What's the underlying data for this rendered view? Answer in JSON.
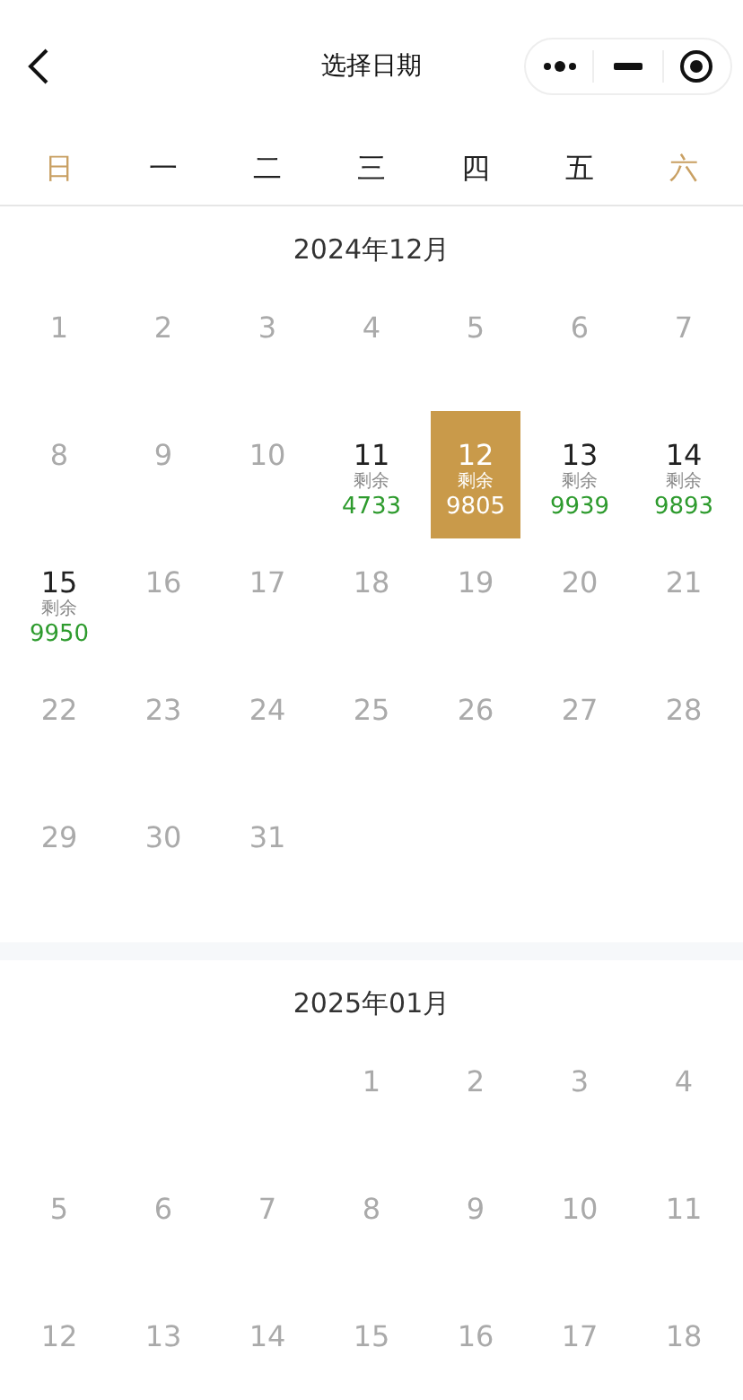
{
  "nav": {
    "title": "选择日期"
  },
  "weekdays": [
    {
      "label": "日",
      "color": "#c9a063"
    },
    {
      "label": "一",
      "color": "#222222"
    },
    {
      "label": "二",
      "color": "#222222"
    },
    {
      "label": "三",
      "color": "#222222"
    },
    {
      "label": "四",
      "color": "#222222"
    },
    {
      "label": "五",
      "color": "#222222"
    },
    {
      "label": "六",
      "color": "#c9a063"
    }
  ],
  "months": [
    {
      "title": "2024年12月",
      "days": [
        {
          "kind": "day",
          "label": "1",
          "disabled": true,
          "selected": false
        },
        {
          "kind": "day",
          "label": "2",
          "disabled": true,
          "selected": false
        },
        {
          "kind": "day",
          "label": "3",
          "disabled": true,
          "selected": false
        },
        {
          "kind": "day",
          "label": "4",
          "disabled": true,
          "selected": false
        },
        {
          "kind": "day",
          "label": "5",
          "disabled": true,
          "selected": false
        },
        {
          "kind": "day",
          "label": "6",
          "disabled": true,
          "selected": false
        },
        {
          "kind": "day",
          "label": "7",
          "disabled": true,
          "selected": false
        },
        {
          "kind": "day",
          "label": "8",
          "disabled": true,
          "selected": false
        },
        {
          "kind": "day",
          "label": "9",
          "disabled": true,
          "selected": false
        },
        {
          "kind": "day",
          "label": "10",
          "disabled": true,
          "selected": false
        },
        {
          "kind": "day",
          "label": "11",
          "disabled": false,
          "selected": false,
          "caption": "剩余",
          "count": "4733"
        },
        {
          "kind": "day",
          "label": "12",
          "disabled": false,
          "selected": true,
          "caption": "剩余",
          "count": "9805"
        },
        {
          "kind": "day",
          "label": "13",
          "disabled": false,
          "selected": false,
          "caption": "剩余",
          "count": "9939"
        },
        {
          "kind": "day",
          "label": "14",
          "disabled": false,
          "selected": false,
          "caption": "剩余",
          "count": "9893"
        },
        {
          "kind": "day",
          "label": "15",
          "disabled": false,
          "selected": false,
          "caption": "剩余",
          "count": "9950"
        },
        {
          "kind": "day",
          "label": "16",
          "disabled": true,
          "selected": false
        },
        {
          "kind": "day",
          "label": "17",
          "disabled": true,
          "selected": false
        },
        {
          "kind": "day",
          "label": "18",
          "disabled": true,
          "selected": false
        },
        {
          "kind": "day",
          "label": "19",
          "disabled": true,
          "selected": false
        },
        {
          "kind": "day",
          "label": "20",
          "disabled": true,
          "selected": false
        },
        {
          "kind": "day",
          "label": "21",
          "disabled": true,
          "selected": false
        },
        {
          "kind": "day",
          "label": "22",
          "disabled": true,
          "selected": false
        },
        {
          "kind": "day",
          "label": "23",
          "disabled": true,
          "selected": false
        },
        {
          "kind": "day",
          "label": "24",
          "disabled": true,
          "selected": false
        },
        {
          "kind": "day",
          "label": "25",
          "disabled": true,
          "selected": false
        },
        {
          "kind": "day",
          "label": "26",
          "disabled": true,
          "selected": false
        },
        {
          "kind": "day",
          "label": "27",
          "disabled": true,
          "selected": false
        },
        {
          "kind": "day",
          "label": "28",
          "disabled": true,
          "selected": false
        },
        {
          "kind": "day",
          "label": "29",
          "disabled": true,
          "selected": false
        },
        {
          "kind": "day",
          "label": "30",
          "disabled": true,
          "selected": false
        },
        {
          "kind": "day",
          "label": "31",
          "disabled": true,
          "selected": false
        }
      ]
    },
    {
      "title": "2025年01月",
      "days": [
        {
          "kind": "blank"
        },
        {
          "kind": "blank"
        },
        {
          "kind": "blank"
        },
        {
          "kind": "day",
          "label": "1",
          "disabled": true,
          "selected": false
        },
        {
          "kind": "day",
          "label": "2",
          "disabled": true,
          "selected": false
        },
        {
          "kind": "day",
          "label": "3",
          "disabled": true,
          "selected": false
        },
        {
          "kind": "day",
          "label": "4",
          "disabled": true,
          "selected": false
        },
        {
          "kind": "day",
          "label": "5",
          "disabled": true,
          "selected": false
        },
        {
          "kind": "day",
          "label": "6",
          "disabled": true,
          "selected": false
        },
        {
          "kind": "day",
          "label": "7",
          "disabled": true,
          "selected": false
        },
        {
          "kind": "day",
          "label": "8",
          "disabled": true,
          "selected": false
        },
        {
          "kind": "day",
          "label": "9",
          "disabled": true,
          "selected": false
        },
        {
          "kind": "day",
          "label": "10",
          "disabled": true,
          "selected": false
        },
        {
          "kind": "day",
          "label": "11",
          "disabled": true,
          "selected": false
        },
        {
          "kind": "day",
          "label": "12",
          "disabled": true,
          "selected": false
        },
        {
          "kind": "day",
          "label": "13",
          "disabled": true,
          "selected": false
        },
        {
          "kind": "day",
          "label": "14",
          "disabled": true,
          "selected": false
        },
        {
          "kind": "day",
          "label": "15",
          "disabled": true,
          "selected": false
        },
        {
          "kind": "day",
          "label": "16",
          "disabled": true,
          "selected": false
        },
        {
          "kind": "day",
          "label": "17",
          "disabled": true,
          "selected": false
        },
        {
          "kind": "day",
          "label": "18",
          "disabled": true,
          "selected": false
        }
      ]
    }
  ]
}
